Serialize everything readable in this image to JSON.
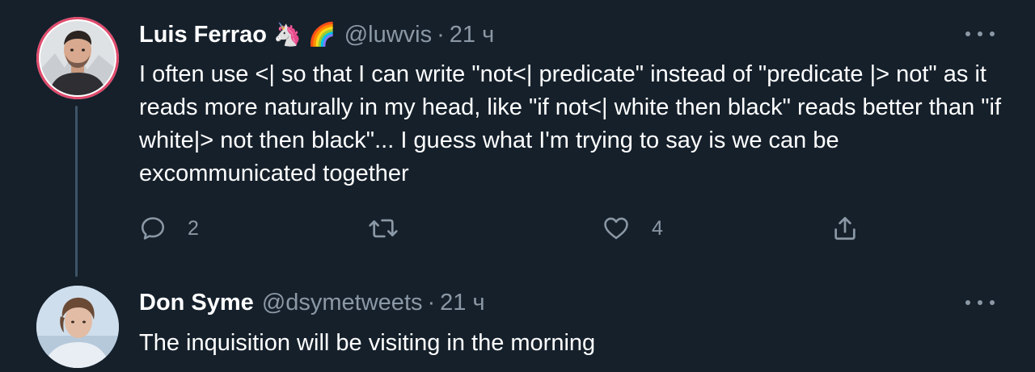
{
  "tweets": [
    {
      "author_name": "Luis Ferrao",
      "author_emojis": [
        "🦄",
        "🌈"
      ],
      "handle": "@luwvis",
      "separator": "·",
      "time": "21 ч",
      "text": "I often use <| so that I can write \"not<| predicate\" instead of \"predicate |> not\" as it reads more naturally in my head, like \"if not<| white then black\" reads better than \"if white|> not then black\"... I guess what I'm trying to say is we can be excommunicated together",
      "reply_count": "2",
      "like_count": "4"
    },
    {
      "author_name": "Don Syme",
      "handle": "@dsymetweets",
      "separator": "·",
      "time": "21 ч",
      "text": "The inquisition will be visiting in the morning"
    }
  ],
  "colors": {
    "background": "#15202b",
    "text_primary": "#ffffff",
    "text_secondary": "#8b98a5",
    "thread_line": "#3d5466",
    "avatar_ring": "#e04a6c"
  },
  "icons": {
    "more": "more-horizontal-icon",
    "reply": "reply-icon",
    "retweet": "retweet-icon",
    "like": "heart-icon",
    "share": "share-icon"
  }
}
